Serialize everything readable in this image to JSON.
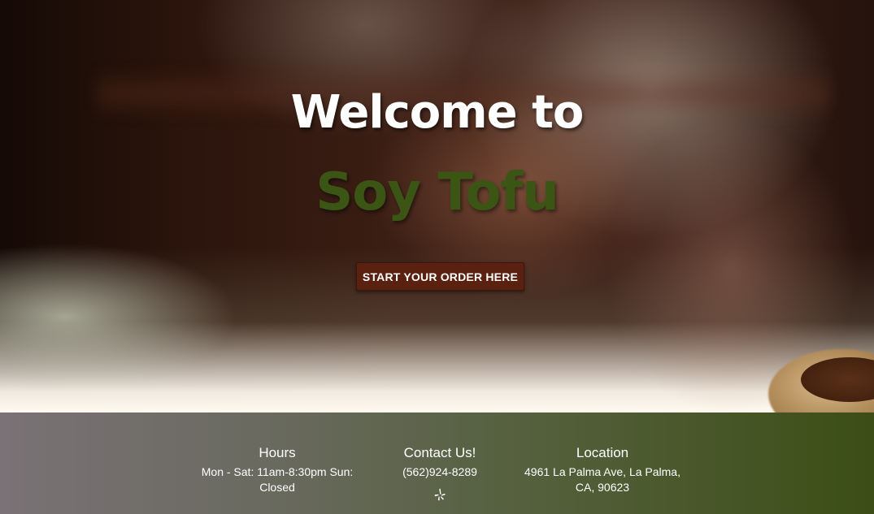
{
  "hero": {
    "title": "Welcome to",
    "brand": "Soy Tofu",
    "order_button_label": "START YOUR ORDER HERE",
    "brand_color": "#3b5514",
    "button_color": "#5a2110"
  },
  "footer": {
    "hours": {
      "heading": "Hours",
      "text": "Mon - Sat: 11am-8:30pm Sun: Closed"
    },
    "contact": {
      "heading": "Contact Us!",
      "phone": "(562)924-8289",
      "social_icon": "yelp-icon"
    },
    "location": {
      "heading": "Location",
      "address": "4961 La Palma Ave, La Palma, CA, 90623"
    }
  }
}
